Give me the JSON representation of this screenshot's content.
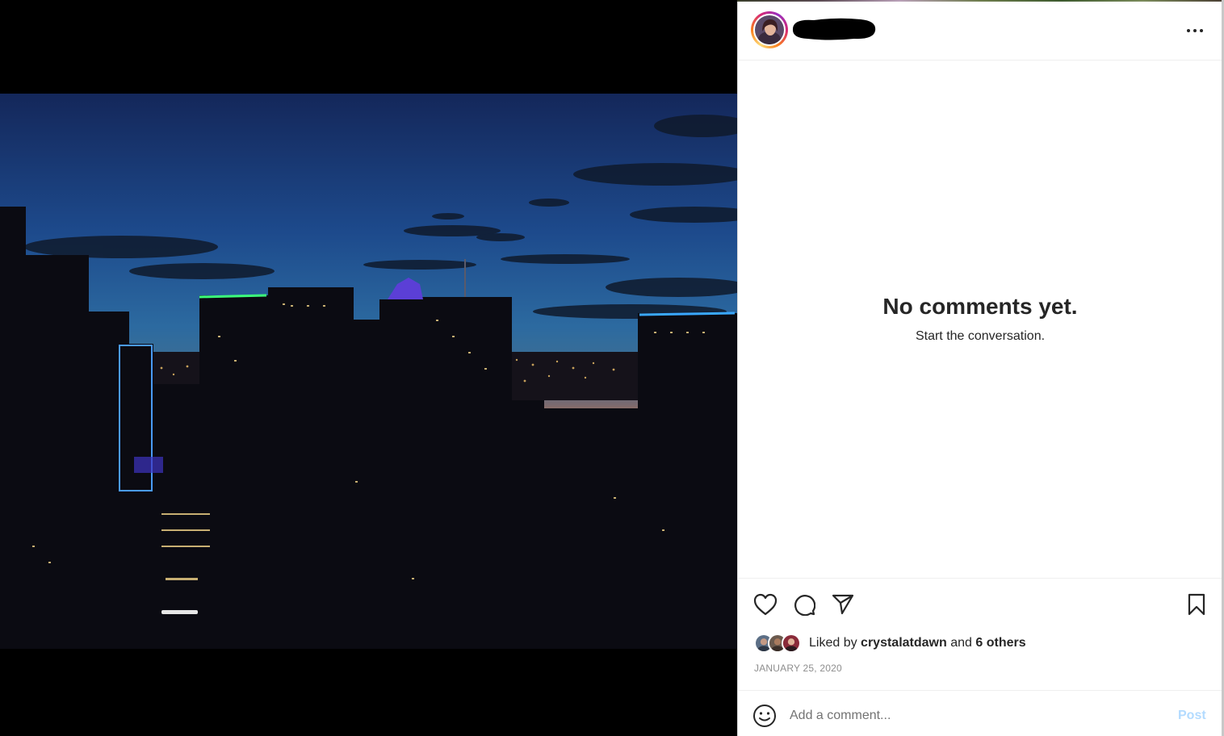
{
  "post": {
    "username": "",
    "more_icon": "more-horizontal-icon"
  },
  "comments": {
    "empty_title": "No comments yet.",
    "empty_subtitle": "Start the conversation."
  },
  "actions": {
    "like_icon": "heart-icon",
    "comment_icon": "comment-icon",
    "share_icon": "send-icon",
    "save_icon": "bookmark-icon"
  },
  "likes": {
    "prefix": "Liked by",
    "user": "crystalatdawn",
    "conjunction": "and",
    "others": "6 others"
  },
  "date": "JANUARY 25, 2020",
  "comment_box": {
    "placeholder": "Add a comment...",
    "emoji_icon": "emoji-icon",
    "post_label": "Post"
  },
  "colors": {
    "post_button_disabled": "#b3dbff",
    "text_primary": "#262626",
    "text_secondary": "#8e8e8e"
  }
}
